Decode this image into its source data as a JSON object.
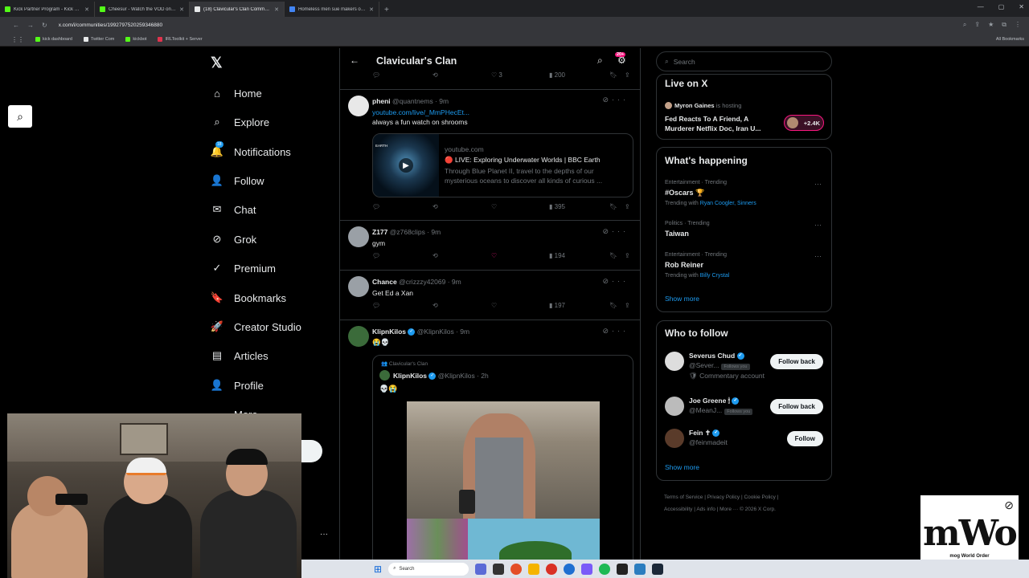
{
  "browser": {
    "tabs": [
      {
        "title": "Kick Partner Program - Kick Da...",
        "color": "#53fc18",
        "active": false
      },
      {
        "title": "Cheesur - Watch the VOD on Ki...",
        "color": "#53fc18",
        "active": false
      },
      {
        "title": "(18) Clavicular's Clan Communi...",
        "color": "#e7e9ea",
        "active": true
      },
      {
        "title": "Homeless men sue makers of '...",
        "color": "#4285f4",
        "active": false
      }
    ],
    "url": "x.com/i/communities/1992797520259346880",
    "bookmarks": [
      {
        "label": "kick dashboard",
        "color": "#53fc18"
      },
      {
        "label": "Twitter Com",
        "color": "#e7e9ea"
      },
      {
        "label": "kickbot",
        "color": "#53fc18"
      },
      {
        "label": "IRLToolkit + Server",
        "color": "#e0334d"
      }
    ],
    "all_bookmarks": "All Bookmarks"
  },
  "left_nav": {
    "notification_badge": "18",
    "items": [
      {
        "label": "Home",
        "icon": "⌂",
        "icon_name": "home-icon"
      },
      {
        "label": "Explore",
        "icon": "⌕",
        "icon_name": "explore-icon"
      },
      {
        "label": "Notifications",
        "icon": "🔔",
        "icon_name": "bell-icon"
      },
      {
        "label": "Follow",
        "icon": "👤",
        "icon_name": "follow-icon"
      },
      {
        "label": "Chat",
        "icon": "✉",
        "icon_name": "chat-icon"
      },
      {
        "label": "Grok",
        "icon": "⊘",
        "icon_name": "grok-icon"
      },
      {
        "label": "Premium",
        "icon": "✓",
        "icon_name": "premium-icon"
      },
      {
        "label": "Bookmarks",
        "icon": "🔖",
        "icon_name": "bookmark-icon"
      },
      {
        "label": "Creator Studio",
        "icon": "🚀",
        "icon_name": "rocket-icon"
      },
      {
        "label": "Articles",
        "icon": "▤",
        "icon_name": "articles-icon"
      },
      {
        "label": "Profile",
        "icon": "👤",
        "icon_name": "profile-icon"
      },
      {
        "label": "More",
        "icon": "⋯",
        "icon_name": "more-icon"
      }
    ]
  },
  "community": {
    "title": "Clavicular's Clan",
    "badge": "20+"
  },
  "posts": {
    "top_actions": {
      "likes": "3",
      "views": "200"
    },
    "pheni": {
      "name": "pheni",
      "handle": "@quantnems · 9m",
      "link": "youtube.com/live/_MmPHecEt...",
      "text": "always a fun watch on shrooms",
      "card_domain": "youtube.com",
      "card_title": "🔴 LIVE: Exploring Underwater Worlds | BBC Earth",
      "card_desc": "Through Blue Planet II, travel to the depths of our mysterious oceans to discover all kinds of curious ...",
      "card_img_label": "EARTH",
      "views": "395"
    },
    "z177": {
      "name": "Z177",
      "handle": "@z768clips · 9m",
      "text": "gym",
      "views": "194"
    },
    "chance": {
      "name": "Chance",
      "handle": "@crizzzy42069 · 9m",
      "text": "Get Ed a Xan",
      "views": "197"
    },
    "klipn": {
      "name": "KlipnKilos",
      "handle": "@KlipnKilos · 9m",
      "text": "😭💀",
      "quote_community": "Clavicular's Clan",
      "quote_name": "KlipnKilos",
      "quote_handle": "@KlipnKilos · 2h",
      "quote_text": "💀😭"
    }
  },
  "right": {
    "search_placeholder": "Search",
    "live": {
      "heading": "Live on X",
      "host": "Myron Gaines",
      "hosting_word": "is hosting",
      "title": "Fed Reacts To A Friend, A Murderer Netflix Doc, Iran U...",
      "count": "+2.4K"
    },
    "happening": {
      "heading": "What's happening",
      "trends": [
        {
          "meta": "Entertainment · Trending",
          "name": "#Oscars 🏆",
          "with_label": "Trending with",
          "with": "Ryan Coogler, Sinners"
        },
        {
          "meta": "Politics · Trending",
          "name": "Taiwan",
          "with_label": "",
          "with": ""
        },
        {
          "meta": "Entertainment · Trending",
          "name": "Rob Reiner",
          "with_label": "Trending with",
          "with": "Billy Crystal"
        }
      ],
      "show_more": "Show more"
    },
    "who_to_follow": {
      "heading": "Who to follow",
      "people": [
        {
          "name": "Severus Chud",
          "handle": "@Sever...",
          "follows_you": "Follows you",
          "extra": "🛡 Commentary account",
          "button": "Follow back"
        },
        {
          "name": "Joe Greene 🕯",
          "handle": "@MeanJ...",
          "follows_you": "Follows you",
          "extra": "",
          "button": "Follow back"
        },
        {
          "name": "Fein ✝",
          "handle": "@feinmadeit",
          "follows_you": "",
          "extra": "",
          "button": "Follow"
        }
      ],
      "show_more": "Show more"
    },
    "footer": {
      "line1": "Terms of Service  |  Privacy Policy  |  Cookie Policy  |",
      "line2": "Accessibility  |  Ads info  |  More ···  © 2026 X Corp."
    }
  },
  "overlay_logo": {
    "big": "mWo",
    "small": "mog World Order"
  },
  "taskbar": {
    "search": "Search"
  }
}
